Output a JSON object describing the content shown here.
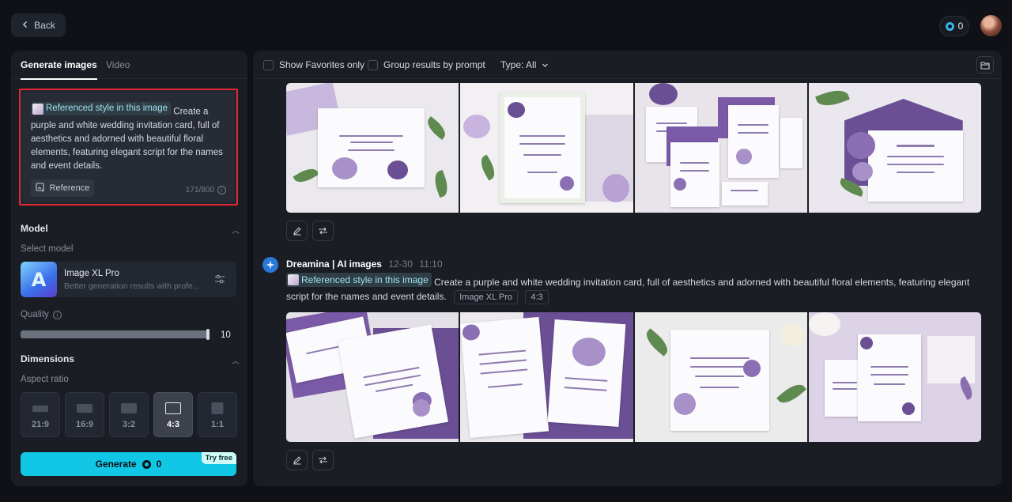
{
  "header": {
    "back_label": "Back",
    "credits": "0"
  },
  "left": {
    "tabs": [
      "Generate images",
      "Video"
    ],
    "prompt": {
      "ref_chip": "Referenced style in this image",
      "text": "Create a purple and white wedding invitation card, full of aesthetics and adorned with beautiful floral elements, featuring elegant script for the names and event details.",
      "reference_btn": "Reference",
      "counter": "171/800"
    },
    "model": {
      "title": "Model",
      "select_label": "Select model",
      "name": "Image XL Pro",
      "desc": "Better generation results with profe..."
    },
    "quality": {
      "label": "Quality",
      "value": "10"
    },
    "dimensions": {
      "title": "Dimensions",
      "aspect_label": "Aspect ratio",
      "ratios": [
        "21:9",
        "16:9",
        "3:2",
        "4:3",
        "1:1"
      ],
      "selected": "4:3"
    },
    "generate": {
      "label": "Generate",
      "cost": "0",
      "badge": "Try free"
    }
  },
  "main": {
    "toolbar": {
      "favorites": "Show Favorites only",
      "group": "Group results by prompt",
      "type": "Type: All"
    },
    "generation": {
      "source": "Dreamina | AI images",
      "date": "12-30",
      "time": "11:10",
      "ref_chip": "Referenced style in this image",
      "prompt": "Create a purple and white wedding invitation card, full of aesthetics and adorned with beautiful floral elements, featuring elegant script for the names and event details.",
      "model_tag": "Image XL Pro",
      "ratio_tag": "4:3"
    }
  },
  "colors": {
    "accent": "#12c6e6",
    "highlight_border": "#e0282e",
    "purple": "#6b4f95",
    "lavender": "#c9b8de"
  }
}
